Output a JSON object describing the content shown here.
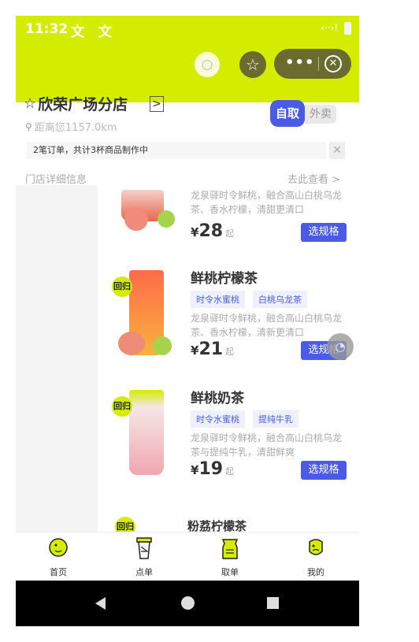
{
  "status_bar": {
    "time": "11:32",
    "notifications": "文 文",
    "signal": "‹··›!"
  },
  "header": {
    "search_icon": "search-icon",
    "star_icon": "star-icon",
    "more_label": "•••",
    "close_label": "✕"
  },
  "store": {
    "name": "欣荣广场分店",
    "redirect": ">",
    "mode_pickup": "自取",
    "mode_delivery": "外卖",
    "distance": "距离您1157.0km",
    "notice": "2笔订单，共计3杯商品制作中",
    "notice_close": "✕",
    "detail_button": "门店详细信息",
    "see_all": "去此查看 >"
  },
  "products": [
    {
      "name": "",
      "badge": "",
      "tags": [],
      "desc": "龙泉驿时令鲜桃，融合高山白桃乌龙茶、香水柠檬，清甜更清口",
      "currency": "¥",
      "price": "28",
      "price_unit": "起",
      "button": "选规格"
    },
    {
      "name": "鲜桃柠檬茶",
      "badge": "回归",
      "tags": [
        "时令水蜜桃",
        "白桃乌龙茶"
      ],
      "desc": "龙泉驿时令鲜桃，融合高山白桃乌龙茶、香水柠檬，清新更清口",
      "currency": "¥",
      "price": "21",
      "price_unit": "起",
      "button": "选规格"
    },
    {
      "name": "鲜桃奶茶",
      "badge": "回归",
      "tags": [
        "时令水蜜桃",
        "提纯牛乳"
      ],
      "desc": "龙泉驿时令鲜桃，融合高山白桃乌龙茶与提纯牛乳，清甜鲜爽",
      "currency": "¥",
      "price": "19",
      "price_unit": "起",
      "button": "选规格"
    }
  ],
  "next_section": {
    "title": "粉荔柠檬茶",
    "badge": "回归"
  },
  "tabs": [
    {
      "label": "首页",
      "icon": "home-icon"
    },
    {
      "label": "点单",
      "icon": "cup-icon"
    },
    {
      "label": "取单",
      "icon": "pickup-icon"
    },
    {
      "label": "我的",
      "icon": "profile-icon"
    }
  ],
  "colors": {
    "brand": "#d4ec00",
    "accent": "#4b5be6",
    "capsule": "#6b6b30"
  }
}
